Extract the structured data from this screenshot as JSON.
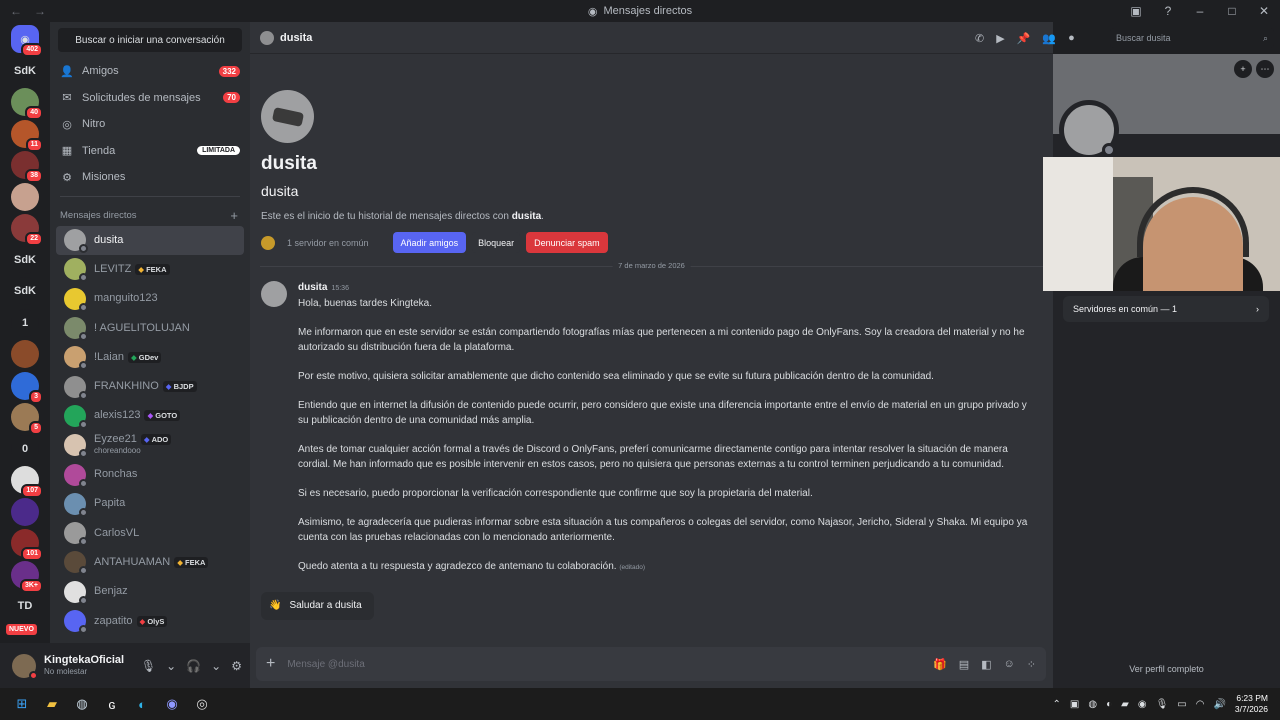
{
  "window": {
    "title": "Mensajes directos"
  },
  "servers": {
    "items": [
      {
        "type": "home",
        "badge": "402",
        "color": "#5865f2"
      },
      {
        "type": "text",
        "label": "SdK"
      },
      {
        "type": "avatar",
        "color": "#6b8f5a",
        "badge": "40"
      },
      {
        "type": "avatar",
        "color": "#b5562a",
        "badge": "11"
      },
      {
        "type": "avatar",
        "color": "#7a2f2f",
        "badge": "38"
      },
      {
        "type": "avatar",
        "color": "#c7a18f"
      },
      {
        "type": "avatar",
        "color": "#8a3a3a",
        "badge": "22"
      },
      {
        "type": "text",
        "label": "SdK"
      },
      {
        "type": "text",
        "label": "SdK"
      },
      {
        "type": "text",
        "label": "1"
      },
      {
        "type": "avatar",
        "color": "#8a4b2a"
      },
      {
        "type": "avatar",
        "color": "#2f6bd8",
        "badge": "3"
      },
      {
        "type": "avatar",
        "color": "#9b7a55",
        "badge": "5"
      },
      {
        "type": "text",
        "label": "0"
      },
      {
        "type": "avatar",
        "color": "#ddd",
        "badge": "107"
      },
      {
        "type": "avatar",
        "color": "#4b2a8a"
      },
      {
        "type": "avatar",
        "color": "#8a2a2a",
        "badge": "101"
      },
      {
        "type": "avatar",
        "color": "#6a2f8a",
        "badge": "3K+"
      },
      {
        "type": "text",
        "label": "TD"
      }
    ],
    "new_label": "NUEVO"
  },
  "sidebar": {
    "search": "Buscar o iniciar una conversación",
    "nav": [
      {
        "label": "Amigos",
        "count": "332",
        "icon": "friends-icon"
      },
      {
        "label": "Solicitudes de mensajes",
        "count": "70",
        "icon": "mail-icon"
      },
      {
        "label": "Nitro",
        "icon": "nitro-icon"
      },
      {
        "label": "Tienda",
        "tag": "LIMITADA",
        "icon": "shop-icon"
      },
      {
        "label": "Misiones",
        "icon": "quests-icon"
      }
    ],
    "dm_header": "Mensajes directos",
    "dms": [
      {
        "name": "dusita",
        "color": "#9fa0a2",
        "active": true
      },
      {
        "name": "LEVITZ",
        "tag": "FEKA",
        "tag_color": "#f0b232",
        "color": "#a0b060"
      },
      {
        "name": "manguito123",
        "color": "#e8c830"
      },
      {
        "name": "! AGUELITOLUJAN",
        "color": "#7b8a6b"
      },
      {
        "name": "!Laian",
        "tag": "GDev",
        "tag_color": "#23a55a",
        "color": "#c9a070"
      },
      {
        "name": "FRANKHINO",
        "tag": "BJDP",
        "tag_color": "#5865f2",
        "color": "#8f8f8f"
      },
      {
        "name": "alexis123",
        "tag": "GOTO",
        "tag_color": "#a855f7",
        "color": "#23a55a"
      },
      {
        "name": "Eyzee21",
        "tag": "ADO",
        "tag_color": "#5865f2",
        "sub": "choreandooo",
        "color": "#d7c3b0"
      },
      {
        "name": "Ronchas",
        "color": "#b04a9a"
      },
      {
        "name": "Papita",
        "color": "#6b8fb0"
      },
      {
        "name": "CarlosVL",
        "color": "#9a9a9a"
      },
      {
        "name": "ANTAHUAMAN",
        "tag": "FEKA",
        "tag_color": "#f0b232",
        "color": "#5a4a3a"
      },
      {
        "name": "Benjaz",
        "color": "#e0e0e0"
      },
      {
        "name": "zapatito",
        "tag": "OlyS",
        "tag_color": "#f23f43",
        "color": "#5865f2"
      }
    ]
  },
  "user": {
    "name": "KingtekaOficial",
    "status": "No molestar"
  },
  "chat": {
    "header": "dusita",
    "search_placeholder": "Buscar dusita",
    "display_name": "dusita",
    "username": "dusita",
    "intro_prefix": "Este es el inicio de tu historial de mensajes directos con ",
    "intro_name": "dusita",
    "intro_suffix": ".",
    "common_servers": "1 servidor en común",
    "btn_add": "Añadir amigos",
    "btn_block": "Bloquear",
    "btn_spam": "Denunciar spam",
    "date": "7 de marzo de 2026",
    "message": {
      "author": "dusita",
      "time": "15:36",
      "paragraphs": [
        "Hola, buenas tardes Kingteka.",
        "Me informaron que en este servidor se están compartiendo fotografías mías que pertenecen a mi contenido pago de OnlyFans. Soy la creadora del material y no he autorizado su distribución fuera de la plataforma.",
        "Por este motivo, quisiera solicitar amablemente que dicho contenido sea eliminado y que se evite su futura publicación dentro de la comunidad.",
        "Entiendo que en internet la difusión de contenido puede ocurrir, pero considero que existe una diferencia importante entre el envío de material en un grupo privado y su publicación dentro de una comunidad más amplia.",
        "Antes de tomar cualquier acción formal a través de Discord o OnlyFans, preferí comunicarme directamente contigo para intentar resolver la situación de manera cordial. Me han informado que es posible intervenir en estos casos, pero no quisiera que personas externas a tu control terminen perjudicando a tu comunidad.",
        "Si es necesario, puedo proporcionar la verificación correspondiente que confirme que soy la propietaria del material.",
        "Asimismo, te agradecería que pudieras informar sobre esta situación a tus compañeros o colegas del servidor, como Najasor, Jericho, Sideral y Shaka. Mi equipo ya cuenta con las pruebas relacionadas con lo mencionado anteriormente.",
        "Quedo atenta a tu respuesta y agradezco de antemano tu colaboración."
      ],
      "edited": "(editado)"
    },
    "wave_label": "Saludar a dusita",
    "composer_placeholder": "Mensaje @dusita"
  },
  "profile": {
    "common_servers": "Servidores en común — 1",
    "full_profile": "Ver perfil completo"
  },
  "taskbar": {
    "time": "6:23 PM",
    "date": "3/7/2026"
  }
}
